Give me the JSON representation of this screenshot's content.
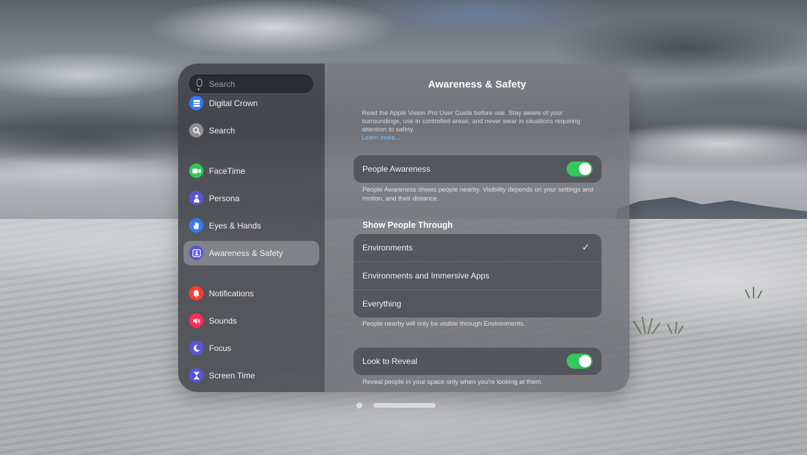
{
  "search": {
    "placeholder": "Search"
  },
  "sidebar": {
    "items": [
      {
        "label": "Digital Crown",
        "icon": "digital-crown-icon",
        "color": "#3478f6"
      },
      {
        "label": "Search",
        "icon": "search-icon",
        "color": "#8e8e93"
      },
      {
        "label": "FaceTime",
        "icon": "facetime-icon",
        "color": "#30c859"
      },
      {
        "label": "Persona",
        "icon": "persona-icon",
        "color": "#5856d6"
      },
      {
        "label": "Eyes & Hands",
        "icon": "hand-icon",
        "color": "#3478f6"
      },
      {
        "label": "Awareness & Safety",
        "icon": "awareness-icon",
        "color": "#5856d6"
      },
      {
        "label": "Notifications",
        "icon": "bell-icon",
        "color": "#ff3b30"
      },
      {
        "label": "Sounds",
        "icon": "speaker-icon",
        "color": "#ff2d55"
      },
      {
        "label": "Focus",
        "icon": "moon-icon",
        "color": "#5856d6"
      },
      {
        "label": "Screen Time",
        "icon": "hourglass-icon",
        "color": "#5856d6"
      }
    ],
    "selected": "Awareness & Safety"
  },
  "main": {
    "title": "Awareness & Safety",
    "intro": "Read the Apple Vision Pro User Guide before use. Stay aware of your surroundings, use in controlled areas, and never wear in situations requiring attention to safety.",
    "learn_more": "Learn more...",
    "people_awareness": {
      "label": "People Awareness",
      "enabled": true,
      "footer": "People Awareness shows people nearby. Visibility depends on your settings and motion, and their distance."
    },
    "show_through": {
      "header": "Show People Through",
      "options": [
        "Environments",
        "Environments and Immersive Apps",
        "Everything"
      ],
      "selected": "Environments",
      "footer": "People nearby will only be visible through Environments."
    },
    "look_to_reveal": {
      "label": "Look to Reveal",
      "enabled": true,
      "footer": "Reveal people in your space only when you're looking at them."
    }
  },
  "colors": {
    "toggle_on": "#34c759",
    "link": "#7fc4ff"
  }
}
